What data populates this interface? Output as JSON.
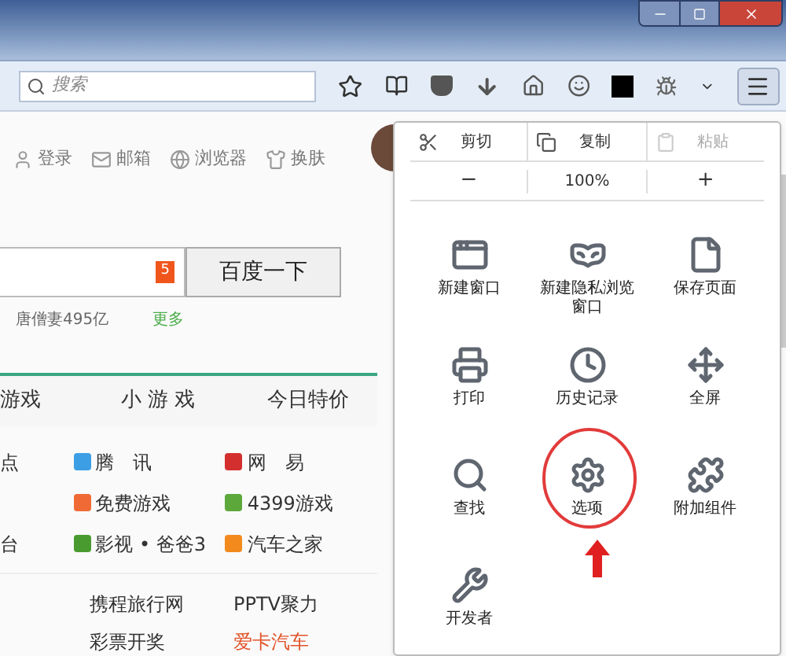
{
  "toolbar": {
    "search": {
      "placeholder": "搜索"
    }
  },
  "page": {
    "top_links": [
      {
        "label": "登录"
      },
      {
        "label": "邮箱"
      },
      {
        "label": "浏览器"
      },
      {
        "label": "换肤"
      }
    ],
    "search_badge": "5",
    "search_button": "百度一下",
    "hot_text": "唐僧妻495亿",
    "more_link": "更多",
    "tabs": [
      "游戏",
      "小 游 戏",
      "今日特价"
    ],
    "links": [
      [
        "点",
        "台"
      ],
      [
        "腾　讯",
        "免费游戏",
        "影视 • 爸爸3"
      ],
      [
        "网　易",
        "4399游戏",
        "汽车之家"
      ]
    ],
    "links_lower": [
      [
        "携程旅行网",
        "PPTV聚力"
      ],
      [
        "彩票开奖",
        "爱卡汽车"
      ]
    ]
  },
  "menu": {
    "edit_row": [
      {
        "label": "剪切",
        "disabled": false
      },
      {
        "label": "复制",
        "disabled": false
      },
      {
        "label": "粘贴",
        "disabled": true
      }
    ],
    "zoom": {
      "minus": "−",
      "level": "100%",
      "plus": "+"
    },
    "items": [
      "新建窗口",
      "新建隐私浏览窗口",
      "保存页面",
      "打印",
      "历史记录",
      "全屏",
      "查找",
      "选项",
      "附加组件",
      "开发者"
    ]
  }
}
